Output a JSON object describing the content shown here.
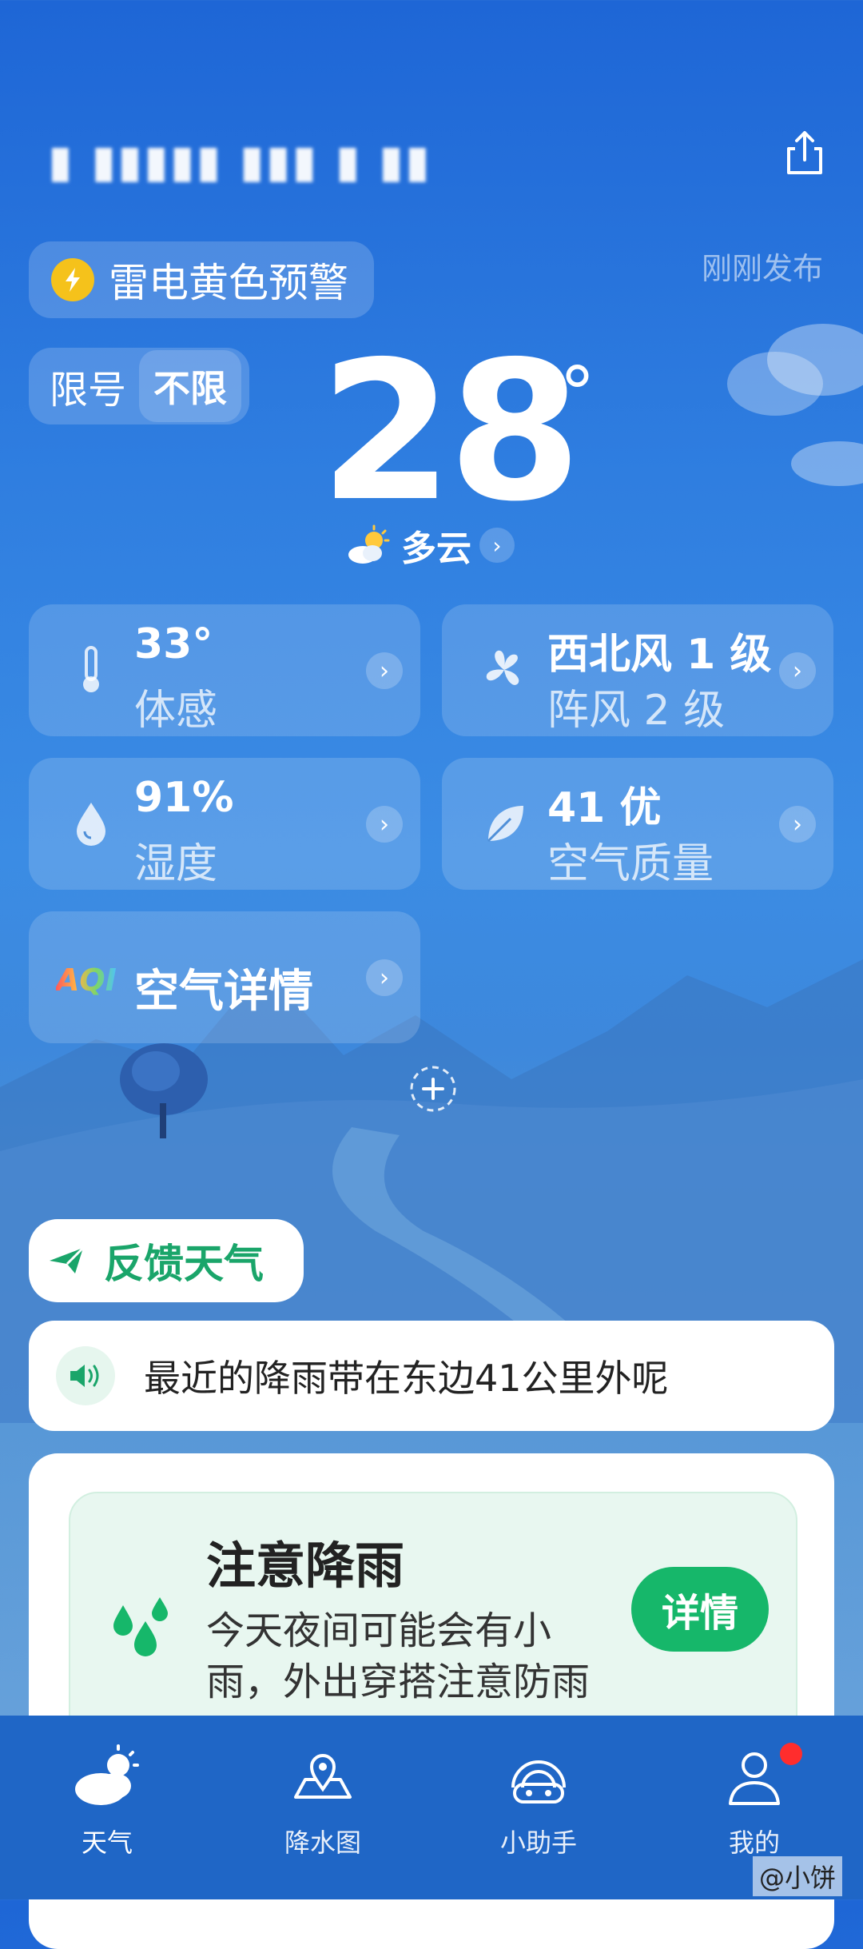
{
  "header": {
    "location_text": "▮ ▮▮▮▮▮ ▮▮▮ ▮ ▮▮",
    "publish_text": "刚刚发布"
  },
  "alert": {
    "text": "雷电黄色预警"
  },
  "traffic_limit": {
    "label": "限号",
    "value": "不限"
  },
  "temperature": {
    "value": "28",
    "unit": "°"
  },
  "condition": {
    "text": "多云"
  },
  "cards": {
    "feels_like": {
      "value": "33°",
      "label": "体感"
    },
    "wind": {
      "value": "西北风 1 级",
      "label": "阵风 2 级"
    },
    "humidity": {
      "value": "91%",
      "label": "湿度"
    },
    "air_quality": {
      "value": "41 优",
      "label": "空气质量"
    },
    "air_detail": {
      "badge": "AQI",
      "label": "空气详情"
    }
  },
  "feedback": {
    "label": "反馈天气"
  },
  "rain_notice": {
    "text": "最近的降雨带在东边41公里外呢"
  },
  "rain_alert": {
    "title": "注意降雨",
    "description": "今天夜间可能会有小雨，外出穿搭注意防雨",
    "button": "详情"
  },
  "nav": {
    "items": [
      {
        "label": "天气",
        "icon": "cloud-sun-icon"
      },
      {
        "label": "降水图",
        "icon": "map-pin-icon"
      },
      {
        "label": "小助手",
        "icon": "assistant-icon"
      },
      {
        "label": "我的",
        "icon": "profile-icon"
      }
    ]
  },
  "watermark": "@小饼",
  "colors": {
    "accent_green": "#16b76a",
    "alert_yellow": "#f5c21b",
    "nav_blue": "#1f66c6"
  }
}
